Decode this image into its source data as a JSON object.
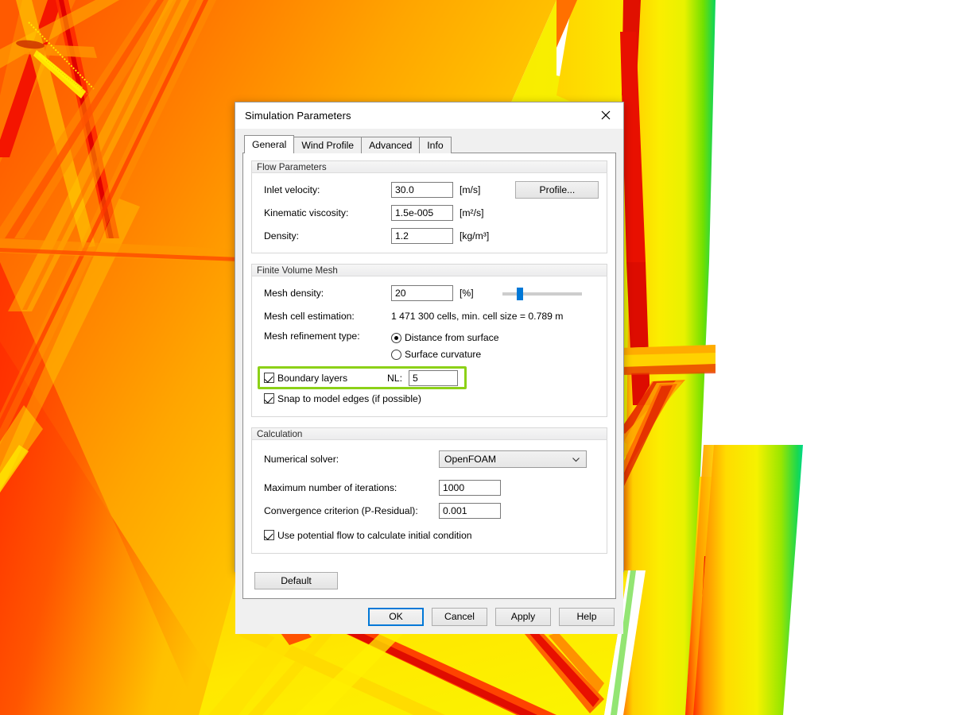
{
  "window": {
    "title": "Simulation Parameters",
    "close_icon": "close-icon"
  },
  "tabs": [
    {
      "label": "General",
      "active": true
    },
    {
      "label": "Wind Profile",
      "active": false
    },
    {
      "label": "Advanced",
      "active": false
    },
    {
      "label": "Info",
      "active": false
    }
  ],
  "flow_parameters": {
    "group_title": "Flow Parameters",
    "inlet_velocity": {
      "label": "Inlet velocity:",
      "value": "30.0",
      "unit": "[m/s]"
    },
    "kinematic_viscosity": {
      "label": "Kinematic viscosity:",
      "value": "1.5e-005",
      "unit": "[m²/s]"
    },
    "density": {
      "label": "Density:",
      "value": "1.2",
      "unit": "[kg/m³]"
    },
    "profile_button": "Profile..."
  },
  "finite_volume_mesh": {
    "group_title": "Finite Volume Mesh",
    "mesh_density": {
      "label": "Mesh density:",
      "value": "20",
      "unit": "[%]",
      "slider_percent": 20
    },
    "mesh_cell_estimation": {
      "label": "Mesh cell estimation:",
      "value": "1 471 300 cells, min. cell size = 0.789 m"
    },
    "mesh_refinement_type": {
      "label": "Mesh refinement type:",
      "options": [
        {
          "label": "Distance from surface",
          "selected": true
        },
        {
          "label": "Surface curvature",
          "selected": false
        }
      ]
    },
    "boundary_layers": {
      "label": "Boundary layers",
      "checked": true,
      "nl_label": "NL:",
      "nl_value": "5",
      "highlighted": true,
      "highlight_color": "#8cd117"
    },
    "snap_to_model_edges": {
      "label": "Snap to model edges (if possible)",
      "checked": true
    }
  },
  "calculation": {
    "group_title": "Calculation",
    "numerical_solver": {
      "label": "Numerical solver:",
      "value": "OpenFOAM",
      "options": [
        "OpenFOAM"
      ]
    },
    "max_iterations": {
      "label": "Maximum number of iterations:",
      "value": "1000"
    },
    "convergence_criterion": {
      "label": "Convergence criterion (P-Residual):",
      "value": "0.001"
    },
    "use_potential_flow": {
      "label": "Use potential flow to calculate initial condition",
      "checked": true
    }
  },
  "buttons": {
    "default": "Default",
    "ok": "OK",
    "cancel": "Cancel",
    "apply": "Apply",
    "help": "Help",
    "ok_focused": true,
    "focus_color": "#0078d7"
  },
  "background": {
    "type": "cfd-pressure-visualization",
    "description": "CFD surface pressure/velocity result on a lattice tower structure",
    "colormap": [
      "#ff2000",
      "#ff6000",
      "#ff9000",
      "#ffc000",
      "#ffe800",
      "#f2f500",
      "#9ee800",
      "#22dd22",
      "#00d978"
    ]
  }
}
